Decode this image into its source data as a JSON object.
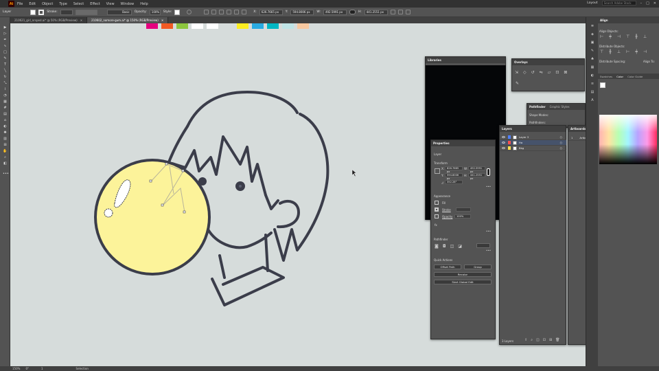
{
  "app": {
    "logo": "Ai",
    "menu": [
      "File",
      "Edit",
      "Object",
      "Type",
      "Select",
      "Effect",
      "View",
      "Window",
      "Help"
    ],
    "workspace": "Layout",
    "search_placeholder": "Search Adobe Stock"
  },
  "control_bar": {
    "selection_label": "Layer",
    "stroke_label": "Stroke:",
    "brush_label": "Basic",
    "opacity_label": "Opacity:",
    "opacity_value": "100%",
    "style_label": "Style:",
    "x_value": "626.7665 px",
    "y_value": "594.8006 px",
    "w_value": "492.5991 px",
    "h_value": "441.2551 px"
  },
  "document_tabs": [
    {
      "label": "210621_girl_nrsped.ai* @ 50% (RGB/Preview)",
      "active": false
    },
    {
      "label": "210602_nomore-gum.ai* @ 150% (RGB/Preview)",
      "active": true
    }
  ],
  "statusbar": {
    "zoom": "150%",
    "rotation": "0°",
    "artboard": "1",
    "tool": "Selection"
  },
  "colors": {
    "bubble_fill": "#fcf39a",
    "line": "#3b3d4a",
    "canvas": "#d6dcdb",
    "swatches": [
      "#e6007e",
      "#f15a24",
      "#8cc63f",
      "#ffffff",
      "#ffffff",
      "#d6dcdb",
      "#fcee21",
      "#29abe2",
      "#00b7c3",
      "#bfe4e6",
      "#f7c8a0"
    ]
  },
  "panels": {
    "libraries": {
      "title": "Libraries"
    },
    "overlays": {
      "title": "Overlays"
    },
    "pathfinder": {
      "title": "Pathfinder",
      "tab2": "Graphic Styles",
      "shape_modes": "Shape Modes:",
      "pathfinders": "Pathfinders:"
    },
    "properties": {
      "title": "Properties",
      "section_layer": "Layer",
      "section_transform": "Transform",
      "x": "626.7665 px",
      "y": "594.8006 px",
      "w": "492.5991 px",
      "h": "441.2551 px",
      "angle": "352.28°",
      "section_appearance": "Appearance",
      "fill_label": "Fill",
      "stroke_label": "Stroke",
      "opacity_label": "Opacity",
      "opacity_value": "100%",
      "section_pathfinder": "Pathfinder",
      "section_quick": "Quick Actions",
      "btn_offset": "Offset Path",
      "btn_group": "Group",
      "btn_recolor": "Recolor",
      "btn_global": "Start Global Edit"
    },
    "layers": {
      "title": "Layers",
      "rows": [
        {
          "name": "Layer 3",
          "color": "#4f7fff"
        },
        {
          "name": "Ha",
          "color": "#ff4f4f"
        },
        {
          "name": "Bkg",
          "color": "#ffdf4f"
        }
      ],
      "count": "3 Layers"
    },
    "artboards": {
      "title": "Artboards",
      "row_num": "1",
      "row_name": "Artboard 1"
    },
    "align": {
      "title": "Align",
      "align_objects": "Align Objects:",
      "distribute_objects": "Distribute Objects:",
      "distribute_spacing": "Distribute Spacing:",
      "align_to": "Align To:"
    },
    "swatch_tabs": [
      "Swatches",
      "Color",
      "Color Guide"
    ]
  }
}
